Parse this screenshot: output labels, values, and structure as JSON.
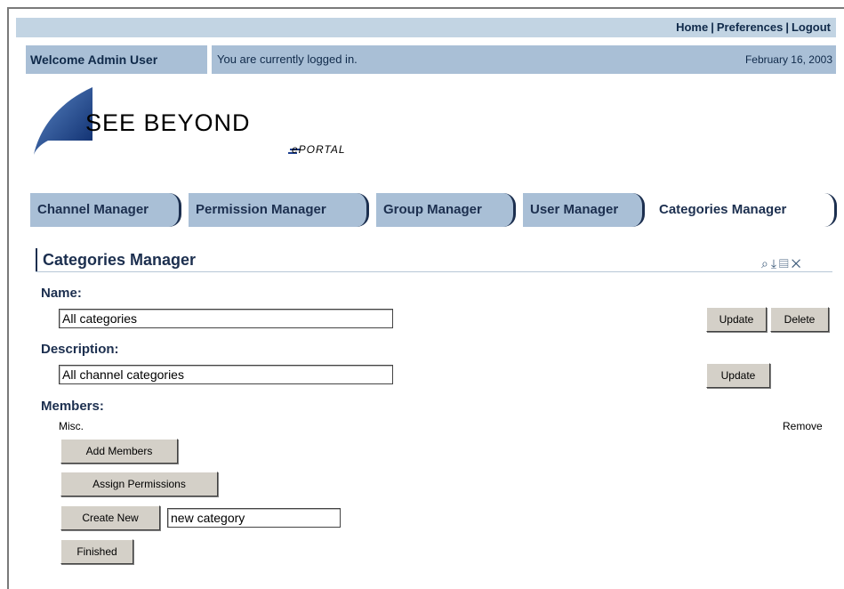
{
  "topnav": {
    "home": "Home",
    "preferences": "Preferences",
    "logout": "Logout",
    "separator": "|"
  },
  "welcome": {
    "text": "Welcome Admin User",
    "status": "You are currently logged in.",
    "date": "February 16, 2003"
  },
  "logo": {
    "brand": "SEE BEYOND",
    "product": "ePORTAL"
  },
  "tabs": [
    {
      "label": "Channel Manager"
    },
    {
      "label": "Permission Manager"
    },
    {
      "label": "Group Manager"
    },
    {
      "label": "User Manager"
    },
    {
      "label": "Categories Manager"
    }
  ],
  "portlet": {
    "title": "Categories Manager",
    "icons": [
      "search-icon",
      "download-icon",
      "edit-icon",
      "close-icon"
    ]
  },
  "form": {
    "name_label": "Name:",
    "name_value": "All categories",
    "update_label": "Update",
    "delete_label": "Delete",
    "description_label": "Description:",
    "description_value": "All channel categories",
    "members_label": "Members:",
    "member_item": "Misc.",
    "remove_label": "Remove",
    "add_members_label": "Add Members",
    "assign_permissions_label": "Assign Permissions",
    "create_new_label": "Create New",
    "new_category_value": "new category",
    "finished_label": "Finished"
  }
}
